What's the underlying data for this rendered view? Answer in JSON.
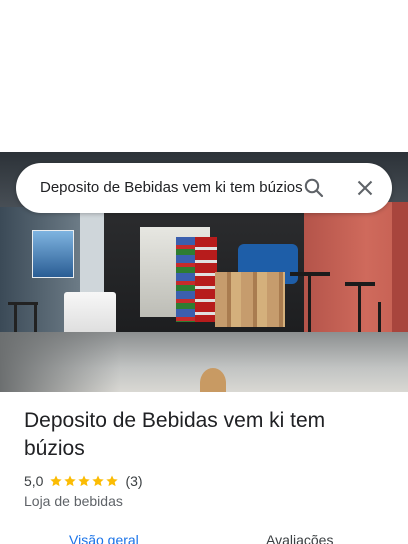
{
  "search": {
    "query": "Deposito de Bebidas vem ki tem búzios",
    "icons": [
      "search-icon",
      "close-icon"
    ]
  },
  "place": {
    "title": "Deposito de Bebidas vem ki tem búzios",
    "rating": "5,0",
    "stars": 5,
    "review_count": "(3)",
    "category": "Loja de bebidas"
  },
  "tabs": [
    {
      "label": "Visão geral",
      "selected": true
    },
    {
      "label": "Avaliações",
      "selected": false
    }
  ],
  "colors": {
    "accent": "#1a73e8",
    "star": "#fbbc04",
    "text": "#202124",
    "secondary_text": "#5f6368"
  }
}
